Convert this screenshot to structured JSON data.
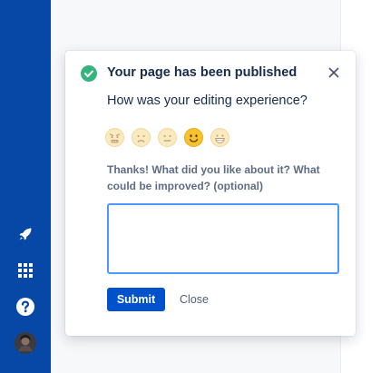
{
  "sidebar": {
    "icons": [
      {
        "name": "rocket-icon"
      },
      {
        "name": "app-switcher-icon"
      },
      {
        "name": "help-icon"
      },
      {
        "name": "avatar"
      }
    ],
    "color": "#0747a6"
  },
  "dialog": {
    "title": "Your page has been published",
    "question": "How was your editing experience?",
    "emojis": [
      {
        "name": "angry-face-icon",
        "selected": false
      },
      {
        "name": "sad-face-icon",
        "selected": false
      },
      {
        "name": "neutral-face-icon",
        "selected": false
      },
      {
        "name": "smiling-face-icon",
        "selected": true
      },
      {
        "name": "grinning-face-icon",
        "selected": false
      }
    ],
    "prompt": "Thanks! What did you like about it? What could be improved? (optional)",
    "feedback_value": "",
    "submit_label": "Submit",
    "close_label": "Close",
    "accent_color": "#0052cc",
    "success_color": "#36b37e"
  }
}
